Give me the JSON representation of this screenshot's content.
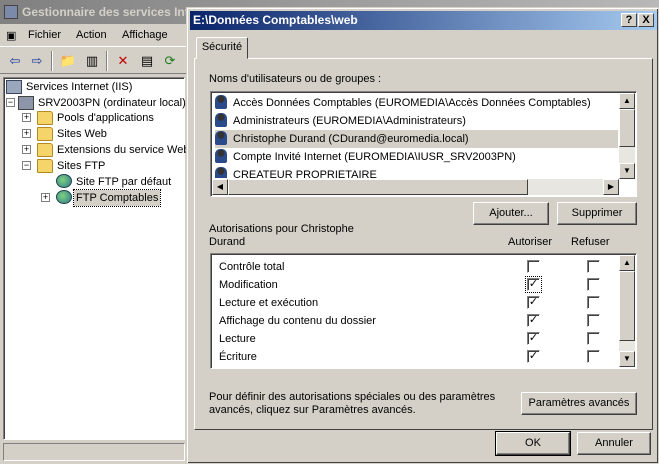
{
  "background_window": {
    "title": "Gestionnaire des services Internet (IIS)",
    "menu": [
      "Fichier",
      "Action",
      "Affichage"
    ],
    "toolbar_icons": [
      "back-arrow-icon",
      "forward-arrow-icon",
      "up-folder-icon",
      "show-tree-icon",
      "delete-icon",
      "properties-icon",
      "refresh-icon"
    ],
    "tree": {
      "root": "Services Internet (IIS)",
      "server": "SRV2003PN (ordinateur local)",
      "items": [
        "Pools d'applications",
        "Sites Web",
        "Extensions du service Web",
        "Sites FTP"
      ],
      "ftp_children": [
        "Site FTP par défaut",
        "FTP Comptables"
      ]
    }
  },
  "dialog": {
    "title": "E:\\Données Comptables\\web",
    "caption_buttons": [
      "?",
      "X"
    ],
    "tab": "Sécurité",
    "users_label": "Noms d'utilisateurs ou de groupes :",
    "users": [
      "Accès Données Comptables (EUROMEDIA\\Accès Données Comptables)",
      "Administrateurs (EUROMEDIA\\Administrateurs)",
      "Christophe Durand (CDurand@euromedia.local)",
      "Compte Invité Internet (EUROMEDIA\\IUSR_SRV2003PN)",
      "CREATEUR PROPRIETAIRE"
    ],
    "selected_user_index": 2,
    "add_button": "Ajouter...",
    "remove_button": "Supprimer",
    "perms_label_line1": "Autorisations pour Christophe",
    "perms_label_line2": "Durand",
    "allow_header": "Autoriser",
    "deny_header": "Refuser",
    "permissions": [
      {
        "name": "Contrôle total",
        "allow": "",
        "deny": ""
      },
      {
        "name": "Modification",
        "allow": "✓",
        "deny": ""
      },
      {
        "name": "Lecture et exécution",
        "allow": "✓",
        "deny": ""
      },
      {
        "name": "Affichage du contenu du dossier",
        "allow": "✓",
        "deny": ""
      },
      {
        "name": "Lecture",
        "allow": "✓",
        "deny": ""
      },
      {
        "name": "Écriture",
        "allow": "✓",
        "deny": ""
      }
    ],
    "advanced_text_line1": "Pour définir des autorisations spéciales ou des paramètres",
    "advanced_text_line2": "avancés, cliquez sur Paramètres avancés.",
    "advanced_button": "Paramètres avancés",
    "ok_button": "OK",
    "cancel_button": "Annuler"
  }
}
